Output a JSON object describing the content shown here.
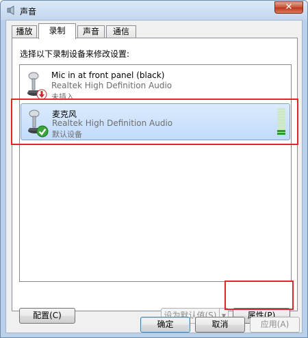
{
  "window": {
    "title": "声音",
    "close_label": "✕"
  },
  "tabs": [
    {
      "label": "播放"
    },
    {
      "label": "录制"
    },
    {
      "label": "声音"
    },
    {
      "label": "通信"
    }
  ],
  "instruction": "选择以下录制设备来修改设置:",
  "devices": [
    {
      "name": "Mic in at front panel (black)",
      "driver": "Realtek High Definition Audio",
      "status": "未插入",
      "state_icon": "unplugged-arrow-icon"
    },
    {
      "name": "麦克风",
      "driver": "Realtek High Definition Audio",
      "status": "默认设备",
      "state_icon": "default-check-icon",
      "level_fraction": 0.2
    }
  ],
  "buttons": {
    "configure": "配置(C)",
    "set_default": "设为默认值(S)",
    "set_default_arrow": "▼",
    "properties": "属性(P)",
    "ok": "确定",
    "cancel": "取消",
    "apply": "应用(A)"
  },
  "colors": {
    "highlight": "#e0262b",
    "selection": "#c1dbfc",
    "meter_on": "#2e9a2a"
  }
}
